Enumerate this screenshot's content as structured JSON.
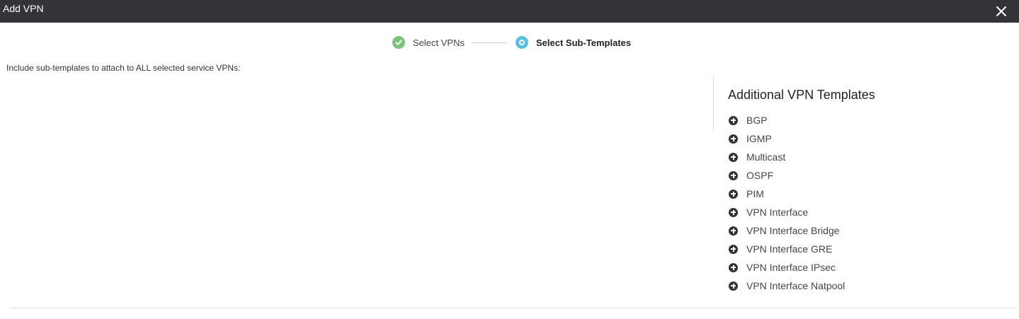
{
  "window": {
    "title": "Add VPN",
    "close_icon": "close-icon"
  },
  "stepper": {
    "steps": [
      {
        "label": "Select VPNs",
        "status": "completed",
        "icon": "check-circle-icon",
        "color": "#7cc27c"
      },
      {
        "label": "Select Sub-Templates",
        "status": "active",
        "icon": "active-step-icon",
        "color": "#5bbfe0"
      }
    ]
  },
  "main": {
    "instruction": "Include sub-templates to attach to ALL selected service VPNs:"
  },
  "sidebar": {
    "title": "Additional VPN Templates",
    "item_icon": "add-circle-icon",
    "items": [
      {
        "label": "BGP"
      },
      {
        "label": "IGMP"
      },
      {
        "label": "Multicast"
      },
      {
        "label": "OSPF"
      },
      {
        "label": "PIM"
      },
      {
        "label": "VPN Interface"
      },
      {
        "label": "VPN Interface Bridge"
      },
      {
        "label": "VPN Interface GRE"
      },
      {
        "label": "VPN Interface IPsec"
      },
      {
        "label": "VPN Interface Natpool"
      }
    ]
  }
}
